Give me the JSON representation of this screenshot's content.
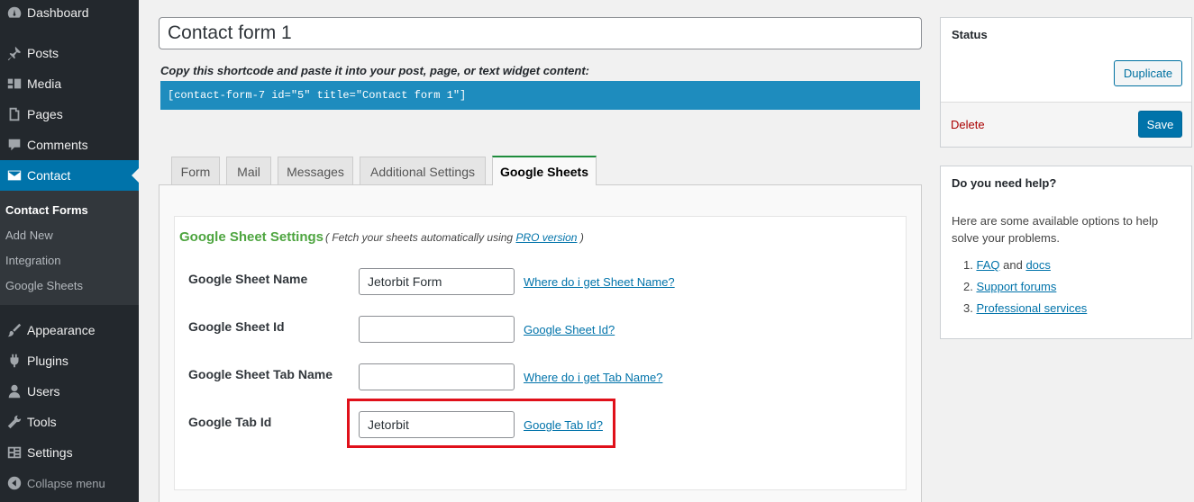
{
  "sidebar": {
    "menu": [
      {
        "label": "Dashboard",
        "icon": "dashboard-icon"
      },
      {
        "label": "Posts",
        "icon": "pin-icon"
      },
      {
        "label": "Media",
        "icon": "media-icon"
      },
      {
        "label": "Pages",
        "icon": "pages-icon"
      },
      {
        "label": "Comments",
        "icon": "comments-icon"
      },
      {
        "label": "Contact",
        "icon": "mail-icon"
      },
      {
        "label": "Appearance",
        "icon": "paintbrush-icon"
      },
      {
        "label": "Plugins",
        "icon": "plugin-icon"
      },
      {
        "label": "Users",
        "icon": "users-icon"
      },
      {
        "label": "Tools",
        "icon": "wrench-icon"
      },
      {
        "label": "Settings",
        "icon": "settings-icon"
      }
    ],
    "submenu": [
      "Contact Forms",
      "Add New",
      "Integration",
      "Google Sheets"
    ],
    "collapse_label": "Collapse menu"
  },
  "editor": {
    "title_value": "Contact form 1",
    "shortcode_label": "Copy this shortcode and paste it into your post, page, or text widget content:",
    "shortcode": "[contact-form-7 id=\"5\" title=\"Contact form 1\"]"
  },
  "tabs": [
    "Form",
    "Mail",
    "Messages",
    "Additional Settings",
    "Google Sheets"
  ],
  "active_tab": "Google Sheets",
  "sheet_settings": {
    "title": "Google Sheet Settings",
    "note_prefix": "( Fetch your sheets automatically using",
    "note_link": "PRO version",
    "note_suffix": ")",
    "rows": [
      {
        "label": "Google Sheet Name",
        "value": "Jetorbit Form",
        "help": "Where do i get Sheet Name?"
      },
      {
        "label": "Google Sheet Id",
        "value": "",
        "help": "Google Sheet Id?"
      },
      {
        "label": "Google Sheet Tab Name",
        "value": "",
        "help": "Where do i get Tab Name?"
      },
      {
        "label": "Google Tab Id",
        "value": "Jetorbit",
        "help": "Google Tab Id?"
      }
    ]
  },
  "status": {
    "title": "Status",
    "duplicate_label": "Duplicate",
    "delete_label": "Delete",
    "save_label": "Save"
  },
  "help": {
    "title": "Do you need help?",
    "text": "Here are some available options to help solve your problems.",
    "item1_num": "1.",
    "item1_link_a": "FAQ",
    "item1_and": "and",
    "item1_link_b": "docs",
    "item2_num": "2.",
    "item2_link": "Support forums",
    "item3_num": "3.",
    "item3_link": "Professional services"
  },
  "colors": {
    "sidebar_bg": "#23282d",
    "accent": "#0073aa",
    "shortcode_bg": "#1e8cbe",
    "settings_title": "#4ea540",
    "highlight": "#e0101a"
  }
}
